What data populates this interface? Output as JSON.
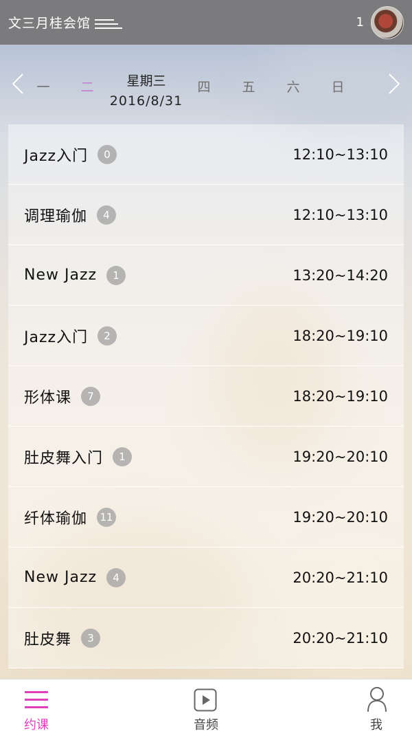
{
  "header": {
    "title": "文三月桂会馆",
    "notification_count": "1"
  },
  "week": {
    "days": [
      "一",
      "二",
      "四",
      "五",
      "六",
      "日"
    ],
    "current_day": "星期三",
    "current_date": "2016/8/31",
    "accent_color": "#c47ccf"
  },
  "classes": [
    {
      "name": "Jazz入门",
      "count": "0",
      "time": "12:10~13:10"
    },
    {
      "name": "调理瑜伽",
      "count": "4",
      "time": "12:10~13:10"
    },
    {
      "name": "New Jazz",
      "count": "1",
      "time": "13:20~14:20"
    },
    {
      "name": "Jazz入门",
      "count": "2",
      "time": "18:20~19:10"
    },
    {
      "name": "形体课",
      "count": "7",
      "time": "18:20~19:10"
    },
    {
      "name": "肚皮舞入门",
      "count": "1",
      "time": "19:20~20:10"
    },
    {
      "name": "纤体瑜伽",
      "count": "11",
      "time": "19:20~20:10"
    },
    {
      "name": "New Jazz",
      "count": "4",
      "time": "20:20~21:10"
    },
    {
      "name": "肚皮舞",
      "count": "3",
      "time": "20:20~21:10"
    }
  ],
  "tabs": [
    {
      "label": "约课",
      "icon": "list-icon",
      "active": true
    },
    {
      "label": "音频",
      "icon": "play-icon",
      "active": false
    },
    {
      "label": "我",
      "icon": "person-icon",
      "active": false
    }
  ],
  "colors": {
    "header_bg": "#7b7b7d",
    "tab_active": "#e13fbe",
    "badge_bg": "#a0a0a0"
  }
}
